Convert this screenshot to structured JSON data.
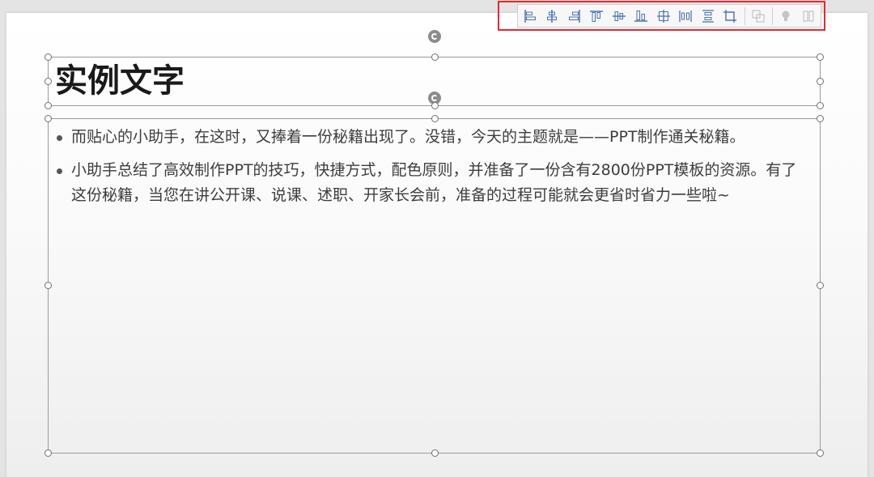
{
  "slide": {
    "title": "实例文字",
    "bullets": [
      "而贴心的小助手，在这时，又捧着一份秘籍出现了。没错，今天的主题就是——PPT制作通关秘籍。",
      "小助手总结了高效制作PPT的技巧，快捷方式，配色原则，并准备了一份含有2800份PPT模板的资源。有了这份秘籍，当您在讲公开课、说课、述职、开家长会前，准备的过程可能就会更省时省力一些啦~"
    ]
  },
  "toolbar": {
    "highlight_color": "#e5292d",
    "icon_color": "#4a72b8",
    "disabled_icon_color": "#b8b8b8",
    "tools": [
      {
        "name": "align-left-icon",
        "enabled": true
      },
      {
        "name": "align-center-icon",
        "enabled": true
      },
      {
        "name": "align-right-icon",
        "enabled": true
      },
      {
        "name": "align-top-icon",
        "enabled": true
      },
      {
        "name": "align-middle-icon",
        "enabled": true
      },
      {
        "name": "align-bottom-icon",
        "enabled": true
      },
      {
        "name": "align-center-both-icon",
        "enabled": true
      },
      {
        "name": "distribute-horizontal-icon",
        "enabled": true
      },
      {
        "name": "distribute-vertical-icon",
        "enabled": true
      },
      {
        "name": "crop-icon",
        "enabled": true
      },
      {
        "name": "group-icon",
        "enabled": false
      },
      {
        "name": "lightbulb-icon",
        "enabled": false
      },
      {
        "name": "more-icon",
        "enabled": false
      }
    ]
  }
}
